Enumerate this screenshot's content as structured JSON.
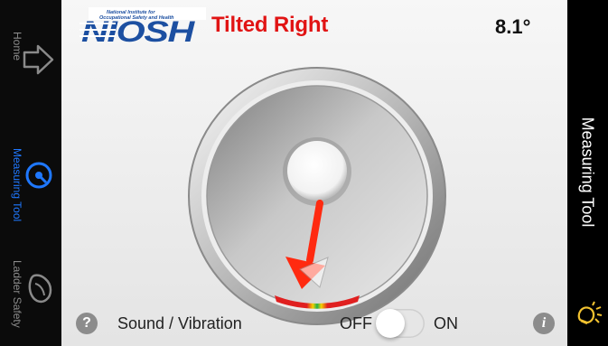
{
  "nav": {
    "items": [
      {
        "label": "Home",
        "icon": "home-arrow-icon",
        "active": false
      },
      {
        "label": "Measuring Tool",
        "icon": "measuring-tool-icon",
        "active": true
      },
      {
        "label": "Ladder Safety",
        "icon": "ladder-safety-icon",
        "active": false
      }
    ]
  },
  "header": {
    "logo_text": "NIOSH",
    "logo_subtext": "National Institute for Occupational Safety and Health",
    "status": "Tilted Right",
    "angle": "8.1°"
  },
  "dial": {
    "tilt_direction": "right",
    "angle_degrees": 8.1
  },
  "controls": {
    "sound_label": "Sound / Vibration",
    "help_icon": "?",
    "toggle_off_label": "OFF",
    "toggle_on_label": "ON",
    "toggle_state": "off",
    "info_icon": "i"
  },
  "right_panel": {
    "title": "Measuring Tool",
    "light_icon": "lamp-icon"
  },
  "colors": {
    "status": "#e11414",
    "active_nav": "#1f78ff",
    "light_icon": "#f2c230",
    "logo_blue": "#1c4fa1"
  }
}
